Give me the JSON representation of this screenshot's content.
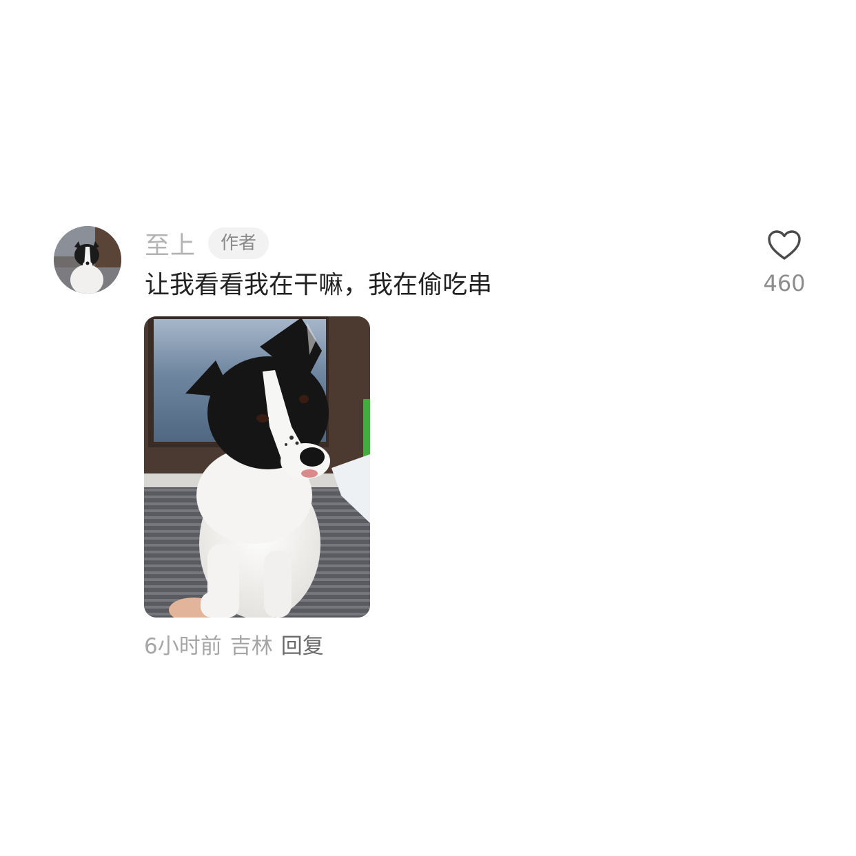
{
  "comment": {
    "author": {
      "name": "至上",
      "badge": "作者",
      "avatar_icon": "border-collie-avatar"
    },
    "text": "让我看看我在干嘛，我在偷吃串",
    "image": {
      "subject": "border-collie-photo"
    },
    "meta": {
      "time": "6小时前",
      "location": "吉林",
      "reply_label": "回复"
    },
    "like": {
      "icon": "heart-outline-icon",
      "count": "460"
    }
  }
}
